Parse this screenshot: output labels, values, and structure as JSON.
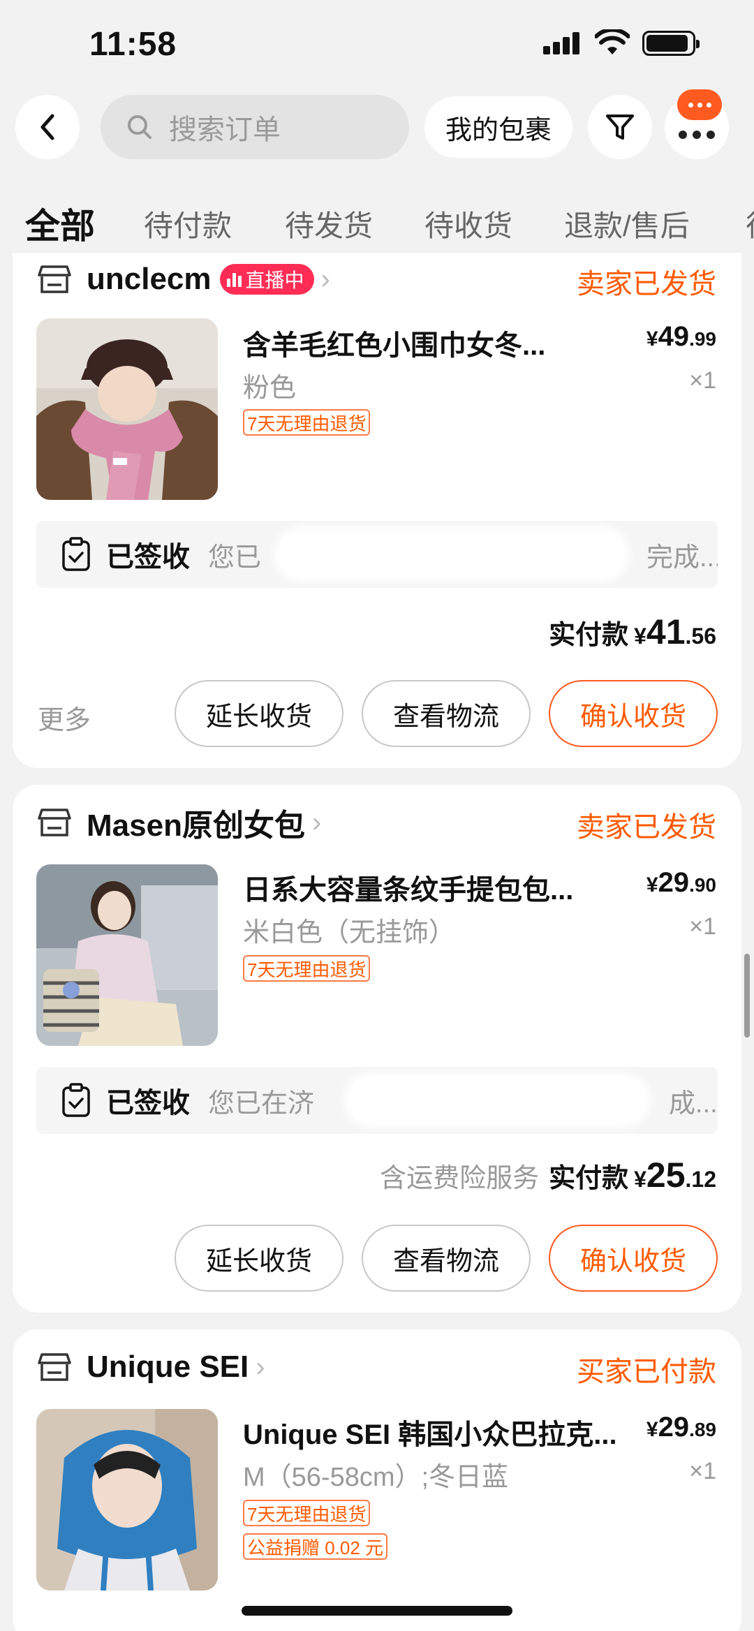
{
  "status_bar": {
    "time": "11:58"
  },
  "nav": {
    "search_placeholder": "搜索订单",
    "package_label": "我的包裹"
  },
  "tabs": [
    "全部",
    "待付款",
    "待发货",
    "待收货",
    "退款/售后"
  ],
  "orders": [
    {
      "shop": "unclecm",
      "live_badge": "直播中",
      "status": "卖家已发货",
      "title": "含羊毛红色小围巾女冬...",
      "price_int": "49",
      "price_dec": ".99",
      "spec": "粉色",
      "qty": "×1",
      "tags": [
        "7天无理由退货"
      ],
      "receipt_label": "已签收",
      "receipt_text_left": "您已",
      "receipt_text_right": "完成...",
      "paid_note": "",
      "paid_label": "实付款",
      "paid_int": "41",
      "paid_dec": ".56",
      "more": "更多",
      "buttons": [
        "延长收货",
        "查看物流",
        "确认收货"
      ]
    },
    {
      "shop": "Masen原创女包",
      "status": "卖家已发货",
      "title": "日系大容量条纹手提包包...",
      "price_int": "29",
      "price_dec": ".90",
      "spec": "米白色（无挂饰）",
      "qty": "×1",
      "tags": [
        "7天无理由退货"
      ],
      "receipt_label": "已签收",
      "receipt_text_left": "您已在济",
      "receipt_text_right": "成...",
      "paid_note": "含运费险服务",
      "paid_label": "实付款",
      "paid_int": "25",
      "paid_dec": ".12",
      "buttons": [
        "延长收货",
        "查看物流",
        "确认收货"
      ]
    },
    {
      "shop": "Unique SEI",
      "status": "买家已付款",
      "title": "Unique SEI 韩国小众巴拉克...",
      "price_int": "29",
      "price_dec": ".89",
      "spec": "M（56-58cm）;冬日蓝",
      "qty": "×1",
      "tags": [
        "7天无理由退货",
        "公益捐赠 0.02 元"
      ]
    }
  ],
  "currency": "¥",
  "colors": {
    "accent": "#ff5a00",
    "live": "#ff2d55",
    "background": "#f2f2f2"
  }
}
